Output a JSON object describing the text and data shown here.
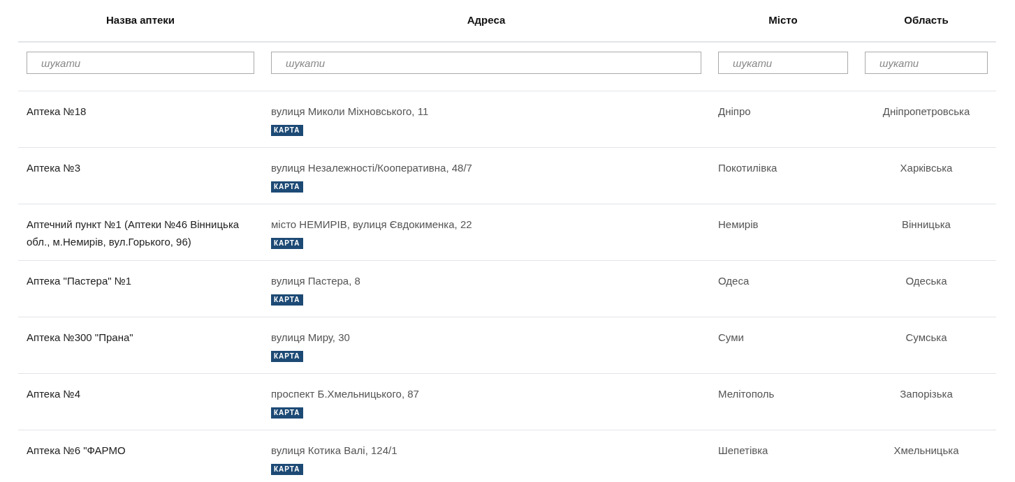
{
  "table": {
    "columns": [
      "Назва аптеки",
      "Адреса",
      "Місто",
      "Область"
    ],
    "filters": [
      {
        "placeholder": "шукати"
      },
      {
        "placeholder": "шукати"
      },
      {
        "placeholder": "шукати"
      },
      {
        "placeholder": "шукати"
      }
    ],
    "rows": [
      {
        "name": "Аптека №18",
        "address": "вулиця Миколи Міхновського, 11",
        "map_button": "КАРТА",
        "city": "Дніпро",
        "region": "Дніпропетровська"
      },
      {
        "name": "Аптека №3",
        "address": "вулиця Незалежності/Кооперативна, 48/7",
        "map_button": "КАРТА",
        "city": "Покотилівка",
        "region": "Харківська"
      },
      {
        "name": "Аптечний пункт №1 (Аптеки №46 Вінницька обл., м.Немирів, вул.Горького, 96)",
        "address": "місто НЕМИРІВ, вулиця Євдокименка, 22",
        "map_button": "КАРТА",
        "city": "Немирів",
        "region": "Вінницька"
      },
      {
        "name": "Аптека \"Пастера\" №1",
        "address": "вулиця Пастера, 8",
        "map_button": "КАРТА",
        "city": "Одеса",
        "region": "Одеська"
      },
      {
        "name": "Аптека №300 \"Прана\"",
        "address": "вулиця Миру, 30",
        "map_button": "КАРТА",
        "city": "Суми",
        "region": "Сумська"
      },
      {
        "name": "Аптека №4",
        "address": "проспект Б.Хмельницького, 87",
        "map_button": "КАРТА",
        "city": "Мелітополь",
        "region": "Запорізька"
      },
      {
        "name": "Аптека №6 \"ФАРМО",
        "address": "вулиця Котика Валі, 124/1",
        "map_button": "КАРТА",
        "city": "Шепетівка",
        "region": "Хмельницька"
      }
    ]
  }
}
